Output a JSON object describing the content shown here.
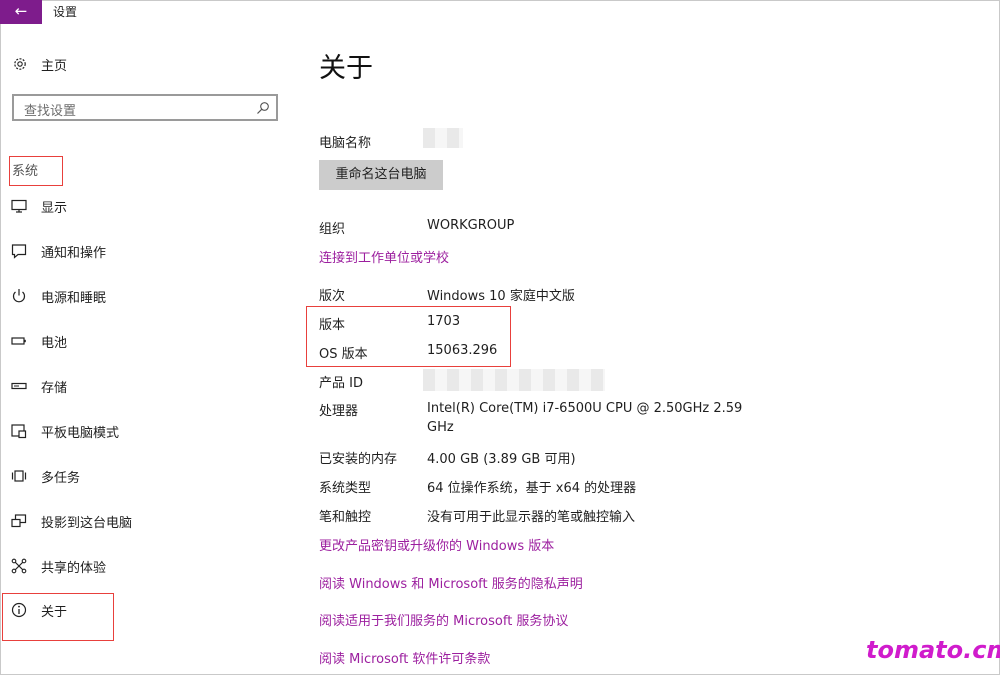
{
  "window": {
    "title": "设置",
    "back_icon": "←"
  },
  "sidebar": {
    "home_label": "主页",
    "search_placeholder": "查找设置",
    "section_label": "系统",
    "items": [
      {
        "label": "显示",
        "icon": "monitor-icon"
      },
      {
        "label": "通知和操作",
        "icon": "notification-icon"
      },
      {
        "label": "电源和睡眠",
        "icon": "power-icon"
      },
      {
        "label": "电池",
        "icon": "battery-icon"
      },
      {
        "label": "存储",
        "icon": "storage-icon"
      },
      {
        "label": "平板电脑模式",
        "icon": "tablet-icon"
      },
      {
        "label": "多任务",
        "icon": "multitask-icon"
      },
      {
        "label": "投影到这台电脑",
        "icon": "project-icon"
      },
      {
        "label": "共享的体验",
        "icon": "share-icon"
      },
      {
        "label": "关于",
        "icon": "info-icon"
      }
    ]
  },
  "main": {
    "title": "关于",
    "pc_name_label": "电脑名称",
    "rename_button": "重命名这台电脑",
    "org_label": "组织",
    "org_value": "WORKGROUP",
    "join_link": "连接到工作单位或学校",
    "edition_label": "版次",
    "edition_value": "Windows 10 家庭中文版",
    "version_label": "版本",
    "version_value": "1703",
    "os_build_label": "OS 版本",
    "os_build_value": "15063.296",
    "product_id_label": "产品 ID",
    "processor_label": "处理器",
    "processor_value_line1": "Intel(R) Core(TM) i7-6500U CPU @ 2.50GHz   2.59",
    "processor_value_line2": "GHz",
    "ram_label": "已安装的内存",
    "ram_value": "4.00 GB (3.89 GB 可用)",
    "system_type_label": "系统类型",
    "system_type_value": "64 位操作系统，基于 x64 的处理器",
    "pen_label": "笔和触控",
    "pen_value": "没有可用于此显示器的笔或触控输入",
    "links": [
      "更改产品密钥或升级你的 Windows 版本",
      "阅读 Windows 和 Microsoft 服务的隐私声明",
      "阅读适用于我们服务的 Microsoft 服务协议",
      "阅读 Microsoft 软件许可条款"
    ]
  },
  "watermark": "tomato.cm",
  "colors": {
    "accent": "#7e1c8c",
    "link": "#9c1f9f",
    "highlight": "#e8403c",
    "watermark": "#d01ccc"
  }
}
